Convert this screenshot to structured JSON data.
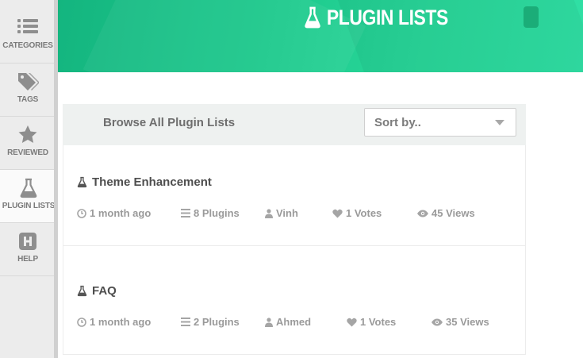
{
  "sidebar": {
    "items": [
      {
        "label": "CATEGORIES",
        "icon": "list-icon"
      },
      {
        "label": "TAGS",
        "icon": "tags-icon"
      },
      {
        "label": "REVIEWED",
        "icon": "star-icon"
      },
      {
        "label": "PLUGIN LISTS",
        "icon": "flask-icon"
      },
      {
        "label": "HELP",
        "icon": "help-h-icon"
      }
    ]
  },
  "header": {
    "title": "PLUGIN LISTS",
    "icon": "flask-icon",
    "brand_color": "#1ec98d"
  },
  "browse": {
    "title": "Browse All Plugin Lists",
    "sort_placeholder": "Sort by.."
  },
  "lists": [
    {
      "title": "Theme Enhancement",
      "time": "1 month ago",
      "plugins": "8 Plugins",
      "author": "Vinh",
      "votes": "1 Votes",
      "views": "45 Views"
    },
    {
      "title": "FAQ",
      "time": "1 month ago",
      "plugins": "2 Plugins",
      "author": "Ahmed",
      "votes": "1 Votes",
      "views": "35 Views"
    }
  ]
}
